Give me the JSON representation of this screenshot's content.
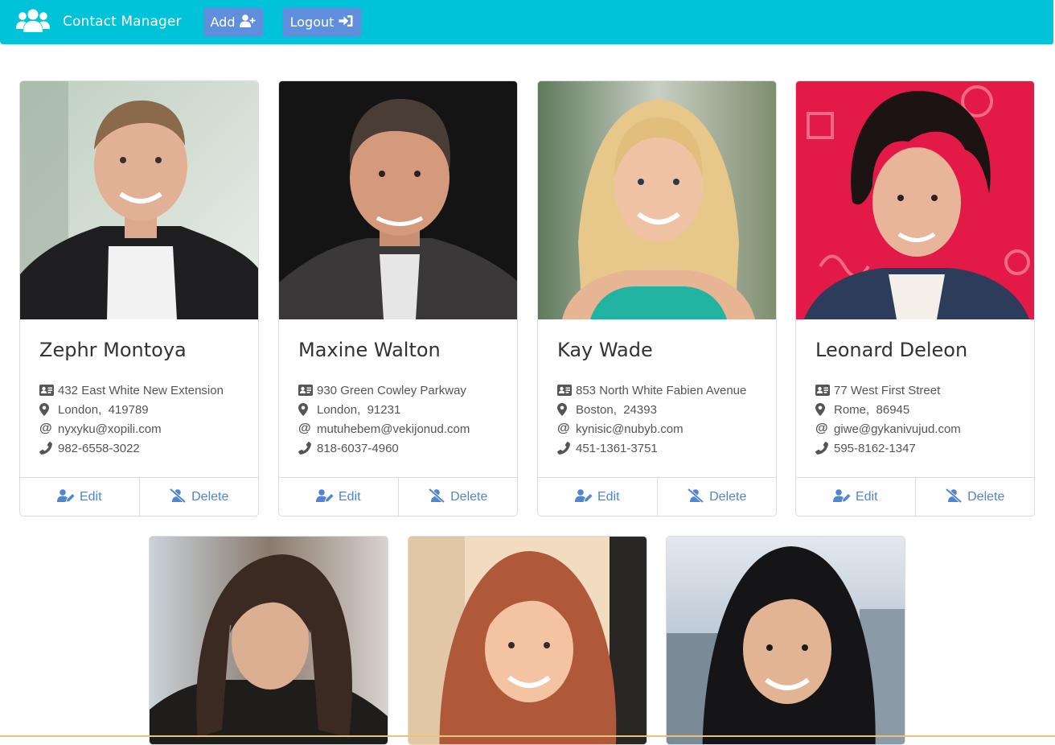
{
  "navbar": {
    "brand": "Contact Manager",
    "brand_icon": "users-icon",
    "add_label": "Add",
    "add_icon": "user-plus-icon",
    "logout_label": "Logout",
    "logout_icon": "sign-in-icon",
    "color": "#00c3d9",
    "button_color": "#5f8fdc"
  },
  "actions": {
    "edit_label": "Edit",
    "delete_label": "Delete",
    "color": "#4e86d1"
  },
  "contacts": [
    {
      "name": "Zephr Montoya",
      "street": "432 East White New Extension",
      "city": "London",
      "zip": "419789",
      "email": "nyxyku@xopili.com",
      "phone": "982-6558-3022"
    },
    {
      "name": "Maxine Walton",
      "street": "930 Green Cowley Parkway",
      "city": "London",
      "zip": "91231",
      "email": "mutuhebem@vekijonud.com",
      "phone": "818-6037-4960"
    },
    {
      "name": "Kay Wade",
      "street": "853 North White Fabien Avenue",
      "city": "Boston",
      "zip": "24393",
      "email": "kynisic@nubyb.com",
      "phone": "451-1361-3751"
    },
    {
      "name": "Leonard Deleon",
      "street": "77 West First Street",
      "city": "Rome",
      "zip": "86945",
      "email": "giwe@gykanivujud.com",
      "phone": "595-8162-1347"
    },
    {
      "name": "",
      "street": "",
      "city": "",
      "zip": "",
      "email": "",
      "phone": ""
    },
    {
      "name": "",
      "street": "",
      "city": "",
      "zip": "",
      "email": "",
      "phone": ""
    },
    {
      "name": "",
      "street": "",
      "city": "",
      "zip": "",
      "email": "",
      "phone": ""
    }
  ]
}
